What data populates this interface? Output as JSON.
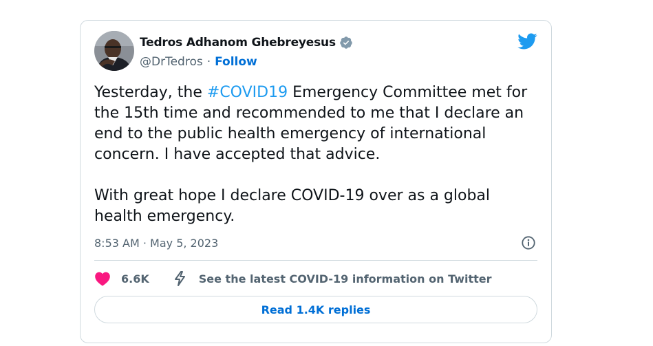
{
  "tweet": {
    "author": {
      "name": "Tedros Adhanom Ghebreyesus",
      "handle": "@DrTedros",
      "separator": "·",
      "follow_label": "Follow",
      "verified": true
    },
    "text": {
      "p1_before": "Yesterday, the ",
      "hashtag": "#COVID19",
      "p1_after": " Emergency Committee met for the 15th time and recommended to me that I declare an end to the public health emergency of international concern. I have accepted that advice.",
      "p2": "With great hope I declare COVID-19 over as a global health emergency."
    },
    "timestamp": "8:53 AM · May 5, 2023",
    "likes": "6.6K",
    "covid_link_label": "See the latest COVID-19 information on Twitter",
    "replies_button_label": "Read 1.4K replies"
  },
  "icons": {
    "verified": "verified-badge-icon",
    "twitter_logo": "twitter-bird-icon",
    "info": "info-icon",
    "like": "heart-icon",
    "covid": "lightning-icon"
  },
  "colors": {
    "link_blue": "#006fd6",
    "hashtag_blue": "#1d9bf0",
    "twitter_blue": "#1d9bf0",
    "heart_pink": "#f91880",
    "text_primary": "#0f1419",
    "text_secondary": "#536471",
    "border": "#cfd9de"
  }
}
